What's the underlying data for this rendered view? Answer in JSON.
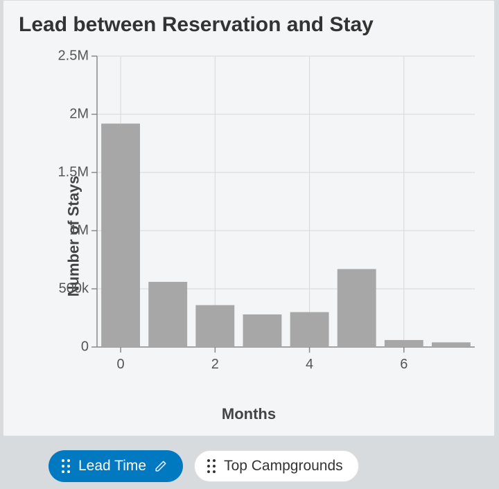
{
  "title": "Lead between Reservation and Stay",
  "yaxis_label": "Number of Stays",
  "xaxis_label": "Months",
  "yticks": [
    "0",
    "500k",
    "1M",
    "1.5M",
    "2M",
    "2.5M"
  ],
  "xticks": [
    "0",
    "2",
    "4",
    "6"
  ],
  "tabs": {
    "lead_time": "Lead Time",
    "top_campgrounds": "Top Campgrounds"
  },
  "chart_data": {
    "type": "bar",
    "title": "Lead between Reservation and Stay",
    "xlabel": "Months",
    "ylabel": "Number of Stays",
    "x": [
      0,
      1,
      2,
      3,
      4,
      5,
      6,
      7
    ],
    "values": [
      1920000,
      560000,
      360000,
      280000,
      300000,
      670000,
      60000,
      40000
    ],
    "ylim": [
      0,
      2500000
    ]
  }
}
